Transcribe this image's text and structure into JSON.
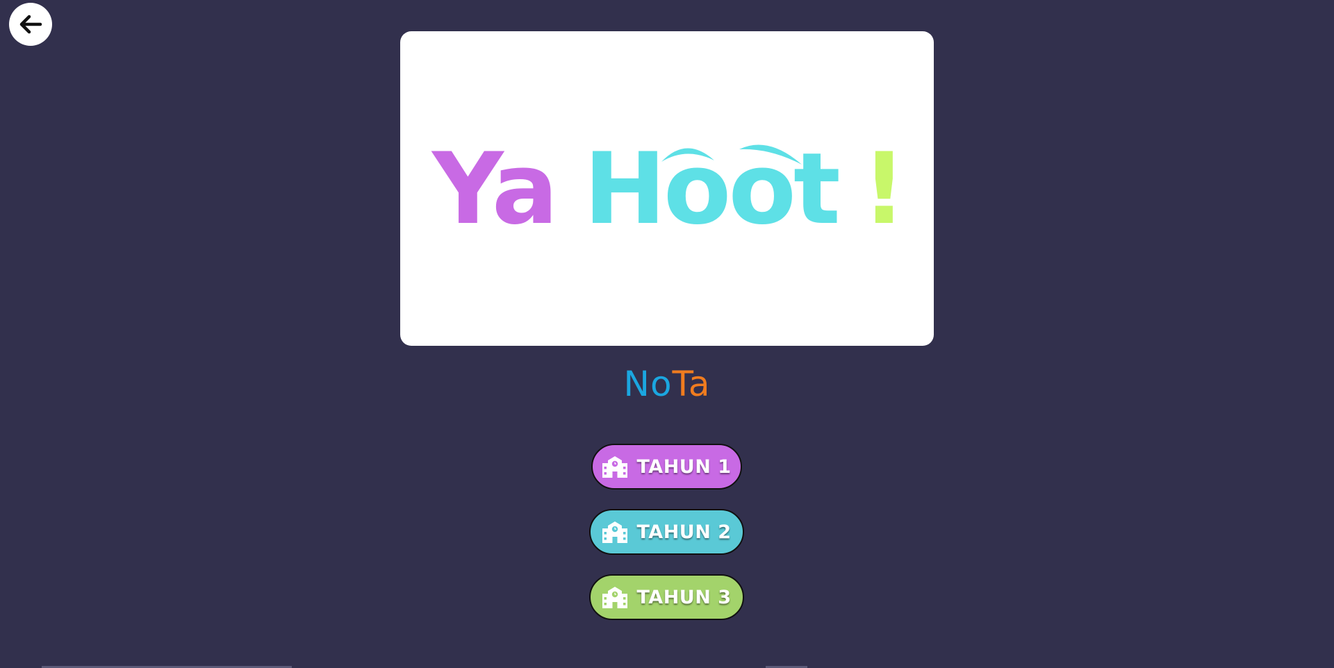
{
  "header": {
    "back_icon": "arrow-left-icon"
  },
  "logo": {
    "part_ya": "Ya",
    "part_hoot": "Hoot",
    "part_exclaim": "!",
    "colors": {
      "ya": "#c86ae4",
      "hoot": "#5ee0e6",
      "exclaim": "#c8f76a"
    }
  },
  "brand": {
    "part1": "No",
    "part2": "Ta",
    "colors": {
      "part1": "#1ba6e0",
      "part2": "#f07c1f"
    }
  },
  "buttons": [
    {
      "label": "TAHUN 1",
      "icon": "school-building-icon",
      "color": "#c86ae4"
    },
    {
      "label": "TAHUN 2",
      "icon": "school-building-icon",
      "color": "#5ac9d6"
    },
    {
      "label": "TAHUN 3",
      "icon": "school-building-icon",
      "color": "#a3d36b"
    }
  ],
  "background": "#32304d"
}
